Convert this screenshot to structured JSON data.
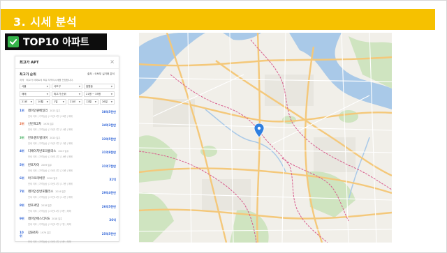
{
  "slide": {
    "title": "3. 시세 분석",
    "section_label": "TOP10 아파트",
    "check_icon": "check-icon",
    "accent_color": "#f6c100",
    "tag_color": "#0d0d0d",
    "check_color": "#35b34a"
  },
  "panel": {
    "title": "최고가 APT",
    "close_icon": "close-icon",
    "subtitle": "최고가 순위",
    "note": "출처 : 국토부 실거래 분석",
    "description": "지역 · 최고가 아파트의 보유 지역이시세를 전망합니다.",
    "filters_row1": [
      "서울",
      "서초구",
      "잠원동"
    ],
    "filters_row2": [
      "매매",
      "최고가 순위",
      "21평 ~ 35평"
    ],
    "filters_row3": [
      "21년",
      "10월",
      "1일",
      "21년",
      "12월",
      "26일"
    ],
    "price_color": "#2f63d6",
    "ranks": [
      {
        "rank": "1위",
        "name": "래미안원베일리",
        "year": "2023 입주",
        "price": "38억5천만",
        "meta": "전세 이후 | 가격상승 | 23년11월 | 28층 | 매매",
        "color": "#2f63d6"
      },
      {
        "rank": "2위",
        "name": "신반포2차",
        "year": "1978 입주",
        "price": "34억3천만",
        "meta": "전세 이후 | 가격상승 | 23년11월 | 14층 | 매매",
        "color": "#e05a2a"
      },
      {
        "rank": "3위",
        "name": "반포센트럴자이",
        "year": "2020 입주",
        "price": "33억5천만",
        "meta": "전세 이후 | 가격상승 | 23년11월 | 12층 | 매매",
        "color": "#35a853"
      },
      {
        "rank": "4위",
        "name": "디에이치반포라클라스",
        "year": "2023 입주",
        "price": "31억8천만",
        "meta": "전세 이후 | 가격상승 | 23년11월 | 16층 | 매매",
        "color": "#2f63d6"
      },
      {
        "rank": "5위",
        "name": "반포자이",
        "year": "2009 입주",
        "price": "31억7천만",
        "meta": "전세 이후 | 가격상승 | 23년11월 | 22층 | 매매",
        "color": "#2f63d6"
      },
      {
        "rank": "6위",
        "name": "아크로리버뷰",
        "year": "2018 입주",
        "price": "31억",
        "meta": "전세 이후 | 가격상승 | 23년11월 | 17층 | 매매",
        "color": "#2f63d6"
      },
      {
        "rank": "7위",
        "name": "래미안신반포팰리스",
        "year": "2016 입주",
        "price": "29억4천만",
        "meta": "전세 이후 | 가격상승 | 23년11월 | 11층 | 매매",
        "color": "#2f63d6"
      },
      {
        "rank": "8위",
        "name": "반포써밋",
        "year": "2018 입주",
        "price": "26억5천만",
        "meta": "전세 이후 | 가격상승 | 23년11월 | 9층 | 매매",
        "color": "#2f63d6"
      },
      {
        "rank": "9위",
        "name": "래미안에스티지S",
        "year": "2018 입주",
        "price": "26억",
        "meta": "전세 이후 | 가격상승 | 23년11월 | 7층 | 매매",
        "color": "#2f63d6"
      },
      {
        "rank": "10위",
        "name": "잠원4차",
        "year": "1979 입주",
        "price": "25억5천만",
        "meta": "전세 이후 | 가격상승 | 23년11월 | 5층 | 매매",
        "color": "#2f63d6"
      }
    ]
  },
  "map": {
    "river_color": "#a9c9e8",
    "park_color": "#cfe4c0",
    "road_color": "#f4c87a",
    "boundary_color": "#d85b8c",
    "marker_color": "#2f7fe0",
    "marker_icon": "location-pin-icon"
  }
}
